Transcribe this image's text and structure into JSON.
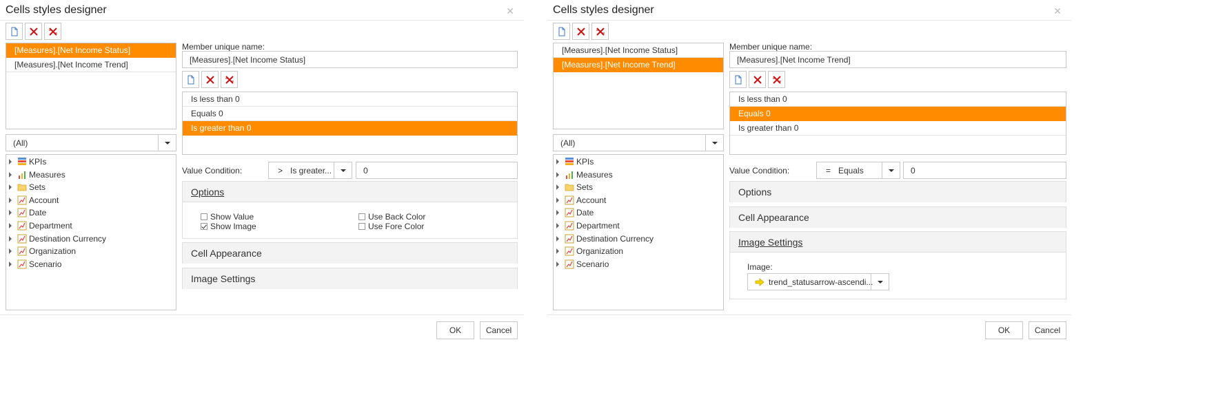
{
  "colors": {
    "selected": "#ff8c00",
    "border": "#c8c8c8",
    "delete_red": "#cc1111"
  },
  "dialogs": [
    {
      "title": "Cells styles designer",
      "members": [
        {
          "label": "[Measures].[Net Income Status]",
          "selected": true
        },
        {
          "label": "[Measures].[Net Income Trend]",
          "selected": false
        }
      ],
      "filter_value": "(All)",
      "tree": [
        {
          "label": "KPIs",
          "icon": "kpi-icon"
        },
        {
          "label": "Measures",
          "icon": "measures-icon"
        },
        {
          "label": "Sets",
          "icon": "folder-icon"
        },
        {
          "label": "Account",
          "icon": "dimension-icon"
        },
        {
          "label": "Date",
          "icon": "dimension-icon"
        },
        {
          "label": "Department",
          "icon": "dimension-icon"
        },
        {
          "label": "Destination Currency",
          "icon": "dimension-icon"
        },
        {
          "label": "Organization",
          "icon": "dimension-icon"
        },
        {
          "label": "Scenario",
          "icon": "dimension-icon"
        }
      ],
      "member_unique_name_label": "Member unique name:",
      "member_unique_name_value": "[Measures].[Net Income Status]",
      "conditions": [
        {
          "label": "Is less than 0",
          "selected": false
        },
        {
          "label": "Equals 0",
          "selected": false
        },
        {
          "label": "Is greater than 0",
          "selected": true
        }
      ],
      "value_condition_label": "Value Condition:",
      "operator_symbol": ">",
      "operator_label": "Is greater...",
      "condition_value": "0",
      "sections": {
        "options": "Options",
        "cell_appearance": "Cell Appearance",
        "image_settings": "Image Settings"
      },
      "options": {
        "show_value": "Show Value",
        "show_image": "Show Image",
        "use_back_color": "Use Back Color",
        "use_fore_color": "Use Fore Color",
        "show_value_checked": false,
        "show_image_checked": true,
        "use_back_color_checked": false,
        "use_fore_color_checked": false
      },
      "ok_label": "OK",
      "cancel_label": "Cancel"
    },
    {
      "title": "Cells styles designer",
      "members": [
        {
          "label": "[Measures].[Net Income Status]",
          "selected": false
        },
        {
          "label": "[Measures].[Net Income Trend]",
          "selected": true
        }
      ],
      "filter_value": "(All)",
      "tree": [
        {
          "label": "KPIs",
          "icon": "kpi-icon"
        },
        {
          "label": "Measures",
          "icon": "measures-icon"
        },
        {
          "label": "Sets",
          "icon": "folder-icon"
        },
        {
          "label": "Account",
          "icon": "dimension-icon"
        },
        {
          "label": "Date",
          "icon": "dimension-icon"
        },
        {
          "label": "Department",
          "icon": "dimension-icon"
        },
        {
          "label": "Destination Currency",
          "icon": "dimension-icon"
        },
        {
          "label": "Organization",
          "icon": "dimension-icon"
        },
        {
          "label": "Scenario",
          "icon": "dimension-icon"
        }
      ],
      "member_unique_name_label": "Member unique name:",
      "member_unique_name_value": "[Measures].[Net Income Trend]",
      "conditions": [
        {
          "label": "Is less than 0",
          "selected": false
        },
        {
          "label": "Equals 0",
          "selected": true
        },
        {
          "label": "Is greater than 0",
          "selected": false
        }
      ],
      "value_condition_label": "Value Condition:",
      "operator_symbol": "=",
      "operator_label": "Equals",
      "condition_value": "0",
      "sections": {
        "options": "Options",
        "cell_appearance": "Cell Appearance",
        "image_settings": "Image Settings"
      },
      "image_label": "Image:",
      "image_value": "trend_statusarrow-ascendi...",
      "ok_label": "OK",
      "cancel_label": "Cancel"
    }
  ]
}
